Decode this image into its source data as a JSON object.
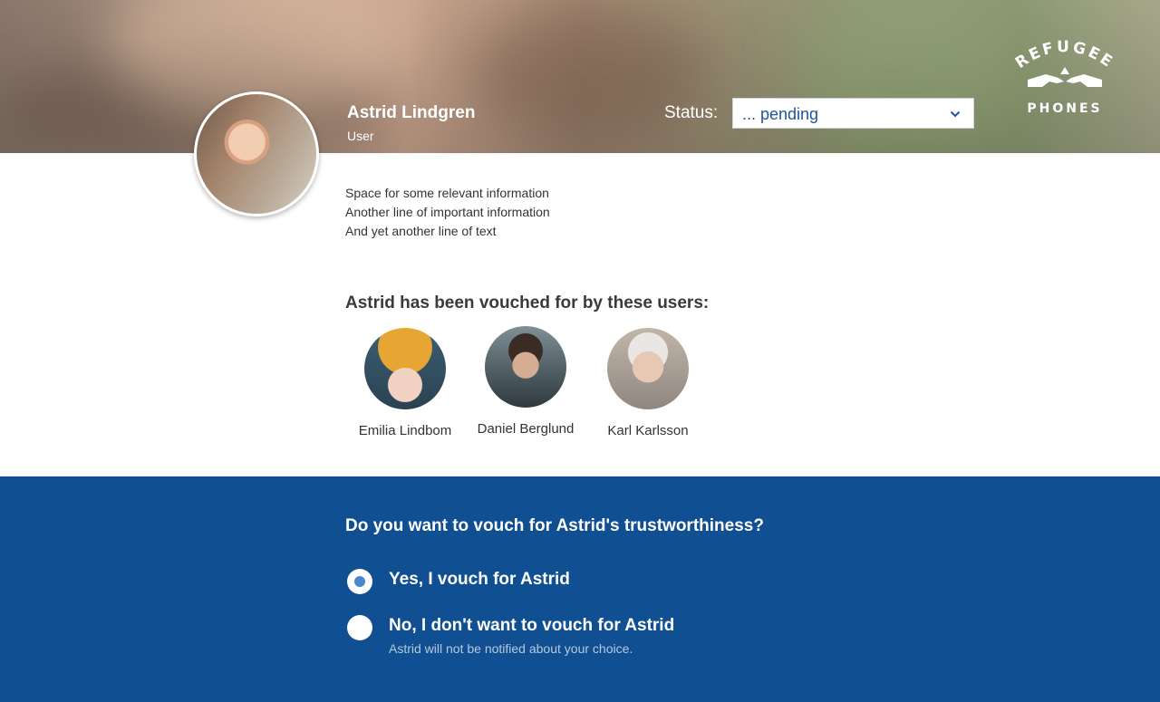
{
  "brand": {
    "logo_top": "REFUGEE",
    "logo_bottom": "PHONES"
  },
  "profile": {
    "name": "Astrid Lindgren",
    "role": "User",
    "status_label": "Status:",
    "status_value": "... pending",
    "info_lines": [
      "Space for some relevant information",
      "Another line of important information",
      "And yet another line of text"
    ]
  },
  "vouchers": {
    "heading": "Astrid has been vouched for by these users:",
    "users": [
      {
        "name": "Emilia Lindbom"
      },
      {
        "name": "Daniel Berglund"
      },
      {
        "name": "Karl Karlsson"
      }
    ]
  },
  "vouch_form": {
    "question": "Do you want to vouch for Astrid's trustworthiness?",
    "options": [
      {
        "label": "Yes, I vouch for Astrid",
        "selected": true
      },
      {
        "label": "No, I don't want to vouch for Astrid",
        "hint": "Astrid will not be notified about your choice.",
        "selected": false
      }
    ]
  },
  "colors": {
    "panel_blue": "#0f4f92",
    "select_text": "#1f5596",
    "radio_selected": "#4a86d0"
  }
}
